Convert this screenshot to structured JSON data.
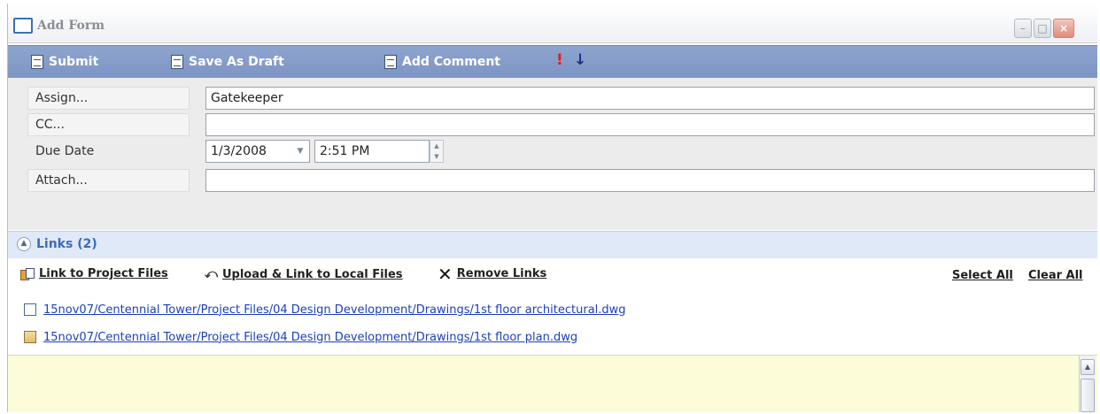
{
  "window": {
    "title": "Add Form",
    "min_label": "–",
    "max_label": "□",
    "close_label": "×"
  },
  "toolbar": {
    "submit_label": "Submit",
    "draft_label": "Save As Draft",
    "comment_label": "Add Comment",
    "priority_high_glyph": "!",
    "priority_low_glyph": "↓"
  },
  "form": {
    "assign_label": "Assign...",
    "assign_value": "Gatekeeper",
    "cc_label": "CC...",
    "cc_value": "",
    "due_label": "Due Date",
    "due_date": "1/3/2008",
    "due_time": "2:51 PM",
    "attach_label": "Attach...",
    "attach_value": ""
  },
  "links": {
    "header": "Links (2)",
    "link_project_label": "Link to Project Files",
    "upload_label": "Upload & Link to Local Files",
    "remove_label": "Remove Links",
    "select_all_label": "Select All",
    "clear_all_label": "Clear All",
    "items": [
      {
        "text": "15nov07/Centennial Tower/Project Files/04 Design Development/Drawings/1st floor architectural.dwg"
      },
      {
        "text": "15nov07/Centennial Tower/Project Files/04 Design Development/Drawings/1st floor plan.dwg"
      }
    ]
  }
}
